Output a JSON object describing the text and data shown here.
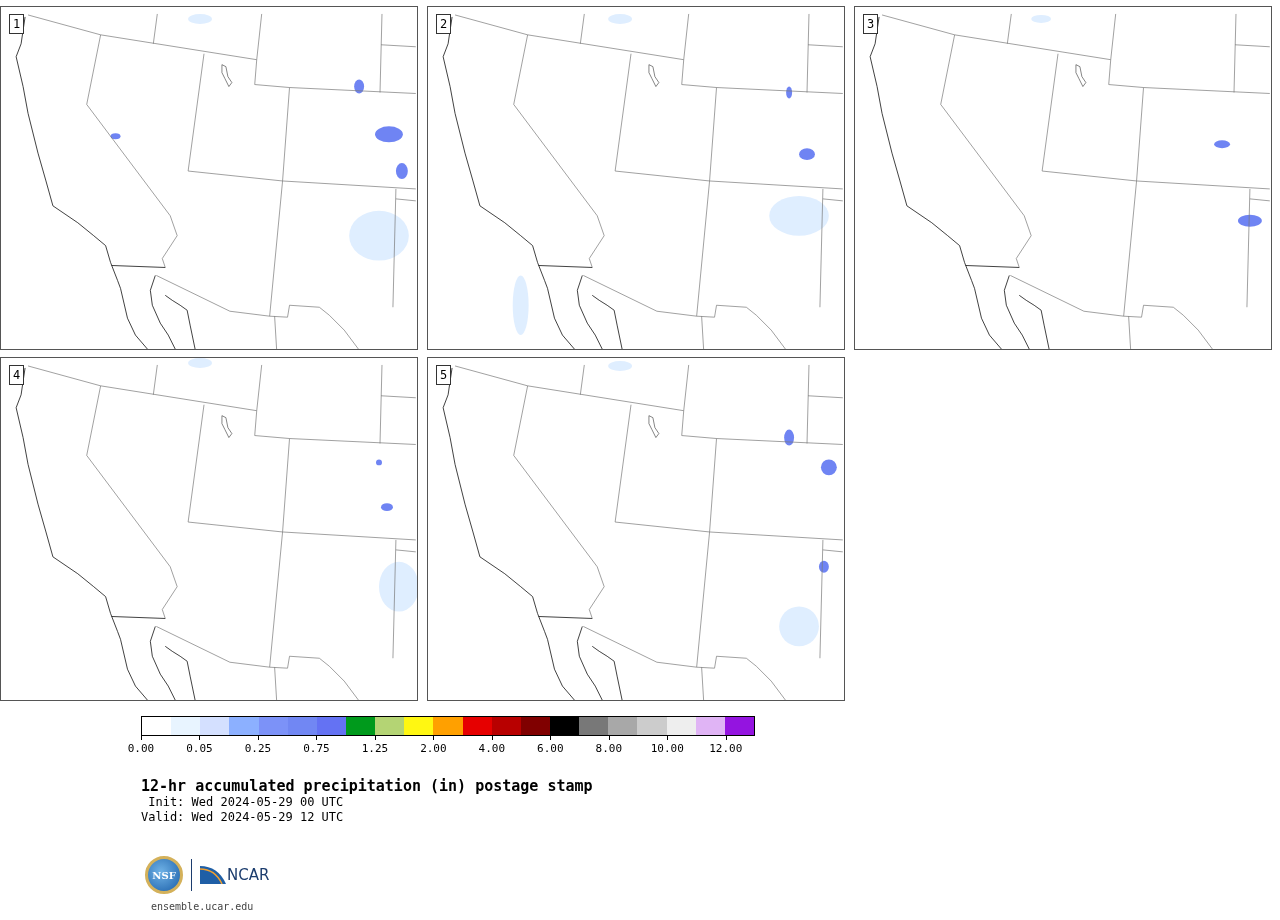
{
  "panels": [
    {
      "label": "1"
    },
    {
      "label": "2"
    },
    {
      "label": "3"
    },
    {
      "label": "4"
    },
    {
      "label": "5"
    }
  ],
  "colorbar": {
    "segments": [
      {
        "color": "#ffffff"
      },
      {
        "color": "#e8f4ff"
      },
      {
        "color": "#d4e0ff"
      },
      {
        "color": "#8cb0ff"
      },
      {
        "color": "#7c92f8"
      },
      {
        "color": "#7187f3"
      },
      {
        "color": "#6472f3"
      },
      {
        "color": "#009a1c"
      },
      {
        "color": "#b4d474"
      },
      {
        "color": "#fff712"
      },
      {
        "color": "#ffa000"
      },
      {
        "color": "#e60000"
      },
      {
        "color": "#b80000"
      },
      {
        "color": "#800000"
      },
      {
        "color": "#000000"
      },
      {
        "color": "#787878"
      },
      {
        "color": "#a8a8a8"
      },
      {
        "color": "#cccccc"
      },
      {
        "color": "#eeeeee"
      },
      {
        "color": "#e0b4f5"
      },
      {
        "color": "#9414e0"
      }
    ],
    "tick_labels": [
      "0.00",
      "0.05",
      "0.25",
      "0.75",
      "1.25",
      "2.00",
      "4.00",
      "6.00",
      "8.00",
      "10.00",
      "12.00"
    ]
  },
  "title": "12-hr accumulated precipitation (in) postage stamp",
  "init": " Init: Wed 2024-05-29 00 UTC",
  "valid": "Valid: Wed 2024-05-29 12 UTC",
  "logos": {
    "nsf": "NSF",
    "ncar": "NCAR"
  },
  "url": "ensemble.ucar.edu"
}
